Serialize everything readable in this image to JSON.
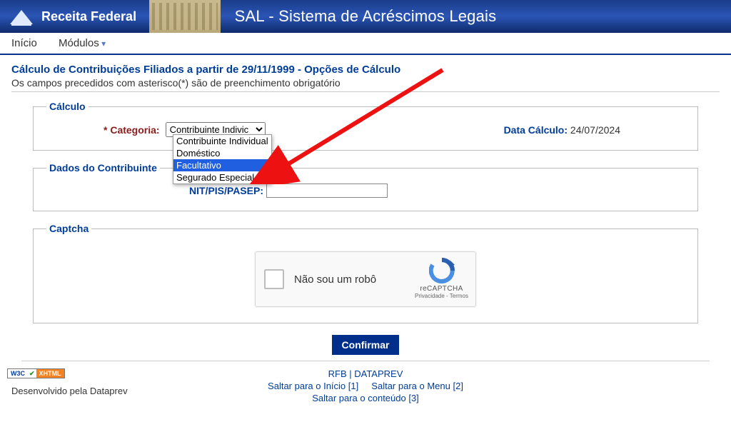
{
  "header": {
    "org": "Receita Federal",
    "system_title": "SAL - Sistema de Acréscimos Legais"
  },
  "menu": {
    "inicio": "Início",
    "modulos": "Módulos"
  },
  "page": {
    "title": "Cálculo de Contribuições Filiados a partir de 29/11/1999 - Opções de Cálculo",
    "required_note": "Os campos precedidos com asterisco(*) são de preenchimento obrigatório"
  },
  "calculo": {
    "legend": "Cálculo",
    "categoria_label": "* Categoria:",
    "categoria_selected": "Contribuinte Indivic",
    "categoria_options": [
      "Contribuinte Individual",
      "Doméstico",
      "Facultativo",
      "Segurado Especial"
    ],
    "categoria_highlight_index": 2,
    "data_label": "Data Cálculo:",
    "data_value": "24/07/2024"
  },
  "contribuinte": {
    "legend": "Dados do Contribuinte",
    "nit_label": "NIT/PIS/PASEP:",
    "nit_value": ""
  },
  "captcha": {
    "legend": "Captcha",
    "label": "Não sou um robô",
    "brand": "reCAPTCHA",
    "links": "Privacidade - Termos"
  },
  "actions": {
    "confirm": "Confirmar"
  },
  "footer": {
    "link_rfb": "RFB",
    "sep": " | ",
    "link_dataprev": "DATAPREV",
    "dev": "Desenvolvido pela Dataprev",
    "skip_inicio": "Saltar para o Início [1]",
    "skip_menu": "Saltar para o Menu [2]",
    "skip_conteudo": "Saltar para o conteúdo [3]",
    "w3c": "W3C",
    "xhtml": "XHTML"
  }
}
